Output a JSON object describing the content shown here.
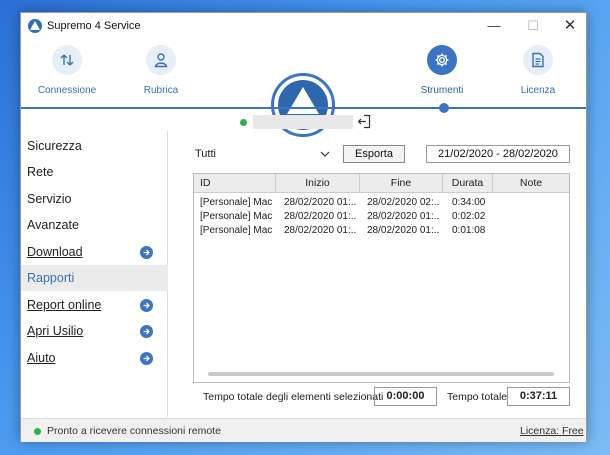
{
  "window": {
    "title": "Supremo 4 Service"
  },
  "toolbar": {
    "items": [
      {
        "label": "Connessione",
        "icon": "transfer-arrows-icon"
      },
      {
        "label": "Rubrica",
        "icon": "person-icon"
      },
      {
        "label": "Strumenti",
        "icon": "gear-icon"
      },
      {
        "label": "Licenza",
        "icon": "document-icon"
      }
    ],
    "active": "Strumenti",
    "accent": "#3a74c2"
  },
  "sidebar": {
    "items": [
      {
        "label": "Sicurezza"
      },
      {
        "label": "Rete"
      },
      {
        "label": "Servizio"
      },
      {
        "label": "Avanzate"
      },
      {
        "label": "Download"
      },
      {
        "label": "Rapporti"
      },
      {
        "label": "Report online"
      },
      {
        "label": "Apri Usilio"
      },
      {
        "label": "Aiuto"
      }
    ],
    "selected": "Rapporti"
  },
  "filters": {
    "type_value": "Tutti",
    "export_label": "Esporta",
    "date_range": "21/02/2020 - 28/02/2020"
  },
  "table": {
    "columns": [
      "ID",
      "Inizio",
      "Fine",
      "Durata",
      "Note"
    ],
    "rows": [
      [
        "[Personale] Mac",
        "28/02/2020 01:...",
        "28/02/2020 02:...",
        "0:34:00",
        ""
      ],
      [
        "[Personale] Mac",
        "28/02/2020 01:...",
        "28/02/2020 01:...",
        "0:02:02",
        ""
      ],
      [
        "[Personale] Mac",
        "28/02/2020 01:...",
        "28/02/2020 01:...",
        "0:01:08",
        ""
      ]
    ]
  },
  "totals": {
    "selected_label": "Tempo totale degli elementi selezionati",
    "selected_value": "0:00:00",
    "total_label": "Tempo totale",
    "total_value": "0:37:11"
  },
  "status": {
    "text": "Pronto a ricevere connessioni remote",
    "license_link": "Licenza: Free",
    "online_color": "#2bb24c"
  }
}
